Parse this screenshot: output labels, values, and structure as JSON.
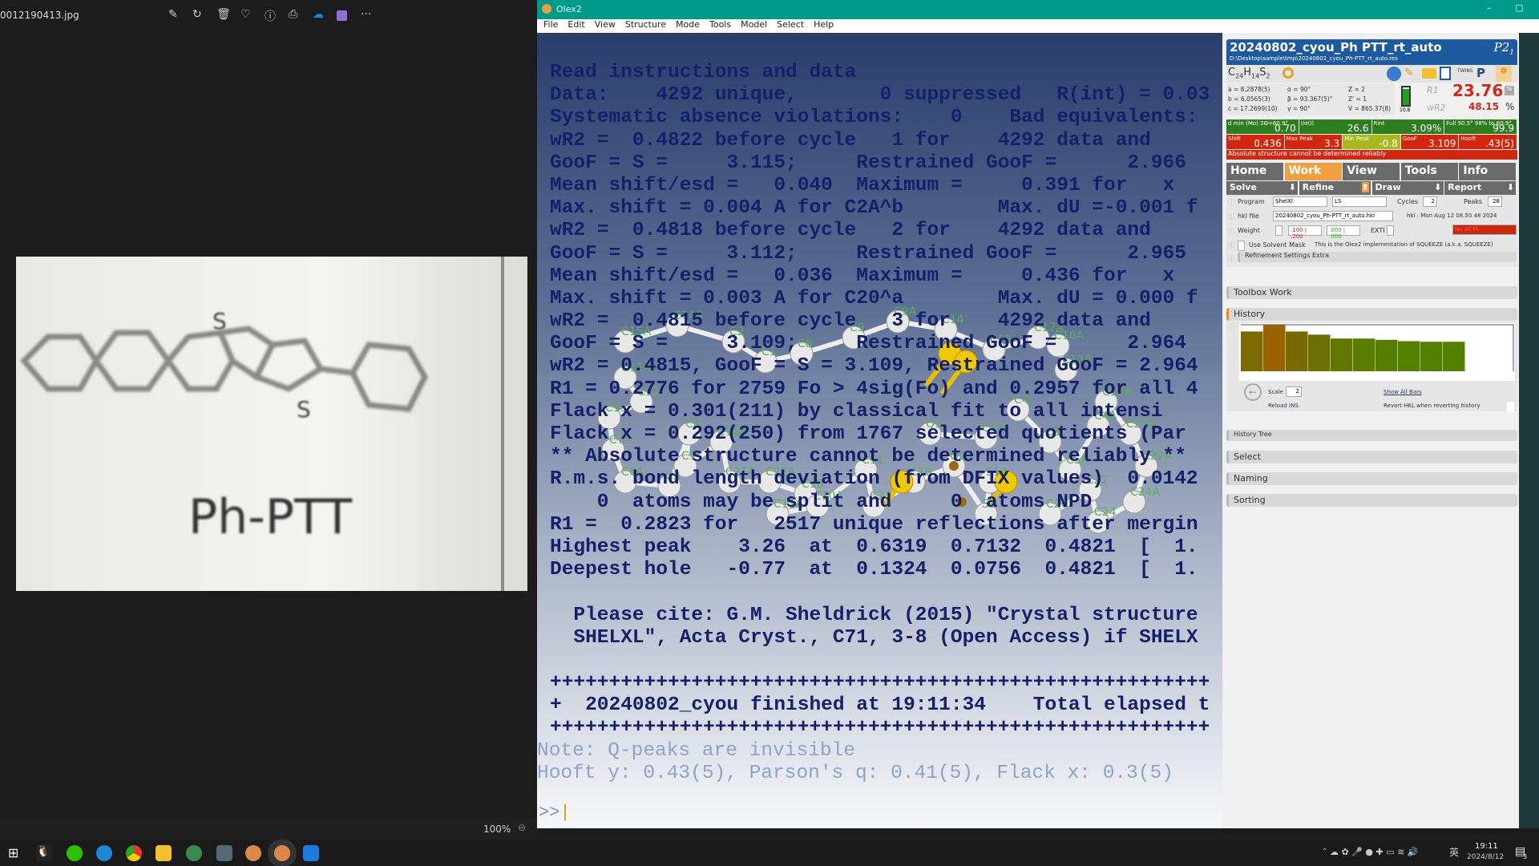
{
  "viewer": {
    "filename": "0012190413.jpg",
    "toolbar_icons": [
      "edit-image-icon",
      "rotate-icon",
      "delete-icon",
      "favorite-icon",
      "info-icon",
      "print-icon",
      "onedrive-icon",
      "clipchamp-icon",
      "more-icon"
    ],
    "more_label": "···",
    "zoom": "100%",
    "photo_label": "Ph-PTT"
  },
  "olex": {
    "title": "Olex2",
    "menu": [
      "File",
      "Edit",
      "View",
      "Structure",
      "Mode",
      "Tools",
      "Model",
      "Select",
      "Help"
    ]
  },
  "console": {
    "lines": [
      "Read instructions and data",
      "Data:    4292 unique,       0 suppressed   R(int) = 0.03",
      "Systematic absence violations:    0    Bad equivalents:",
      "wR2 =  0.4822 before cycle   1 for    4292 data and",
      "GooF = S =     3.115;     Restrained GooF =      2.966",
      "Mean shift/esd =   0.040  Maximum =     0.391 for   x",
      "Max. shift = 0.004 A for C2A^b        Max. dU =-0.001 f",
      "wR2 =  0.4818 before cycle   2 for    4292 data and",
      "GooF = S =     3.112;     Restrained GooF =      2.965",
      "Mean shift/esd =   0.036  Maximum =     0.436 for   x",
      "Max. shift = 0.003 A for C20^a        Max. dU = 0.000 f",
      "wR2 =  0.4815 before cycle   3 for    4292 data and",
      "GooF = S =     3.109;     Restrained GooF =      2.964",
      "wR2 = 0.4815, GooF = S = 3.109, Restrained GooF = 2.964",
      "R1 = 0.2776 for 2759 Fo > 4sig(Fo) and 0.2957 for all 4",
      "Flack x = 0.301(211) by classical fit to all intensi",
      "Flack x = 0.292(250) from 1767 selected quotients (Par",
      "** Absolute structure cannot be determined reliably **",
      "R.m.s. bond length deviation (from DFIX values)  0.0142",
      "    0  atoms may be split and     0  atoms NPD",
      "R1 =  0.2823 for   2517 unique reflections after mergin",
      "Highest peak    3.26  at  0.6319  0.7132  0.4821  [  1.",
      "Deepest hole   -0.77  at  0.1324  0.0756  0.4821  [  1.",
      "",
      "  Please cite: G.M. Sheldrick (2015) \"Crystal structure",
      "  SHELXL\", Acta Cryst., C71, 3-8 (Open Access) if SHELX",
      "",
      "++++++++++++++++++++++++++++++++++++++++++++++++++++++++",
      "+  20240802_cyou finished at 19:11:34    Total elapsed t",
      "++++++++++++++++++++++++++++++++++++++++++++++++++++++++"
    ],
    "notes": [
      "Note: Q-peaks are invisible",
      "Hooft y: 0.43(5), Parson's q: 0.41(5), Flack x: 0.3(5)"
    ],
    "prompt": ">>"
  },
  "atom_labels": [
    "C15A",
    "C14A",
    "C2",
    "C1",
    "C8",
    "C9",
    "C9A",
    "C14",
    "C15",
    "C17A",
    "C16A",
    "C13A",
    "C12A",
    "C12",
    "C13",
    "C7A",
    "C6A",
    "C3",
    "C6",
    "C7",
    "C18A",
    "C21A",
    "C22A",
    "C10",
    "C11A",
    "C10A",
    "C11",
    "C21",
    "C18",
    "Q2",
    "S1",
    "S1A",
    "C4",
    "C5",
    "C5A",
    "C4A",
    "C19A",
    "C20A",
    "C21A",
    "C24A",
    "C24",
    "C22",
    "C20",
    "C19",
    "Q1"
  ],
  "panel": {
    "title": "20240802_cyou_Ph PTT_rt_auto",
    "space_group": "P2",
    "space_group_sub": "1",
    "path": "D:\\Desktop\\sample\\tmp\\20240802_cyou_Ph-PTT_rt_auto.res",
    "formula": {
      "c": "C",
      "c_n": "24",
      "h": "H",
      "h_n": "14",
      "s": "S",
      "s_n": "2"
    },
    "cell": [
      "a = 8.2878(5)",
      "α = 90°",
      "Z = 2",
      "b = 6.0565(3)",
      "β = 93.367(5)°",
      "Z' = 1",
      "c = 17.2699(10)",
      "γ = 90°",
      "V = 865.37(8)"
    ],
    "battery": "10.8",
    "r1_label": "R1",
    "r1": "23.76",
    "wr2_label": "wR2",
    "wr2": "48.15",
    "pct": "%",
    "stats1": [
      {
        "label": "d min (Mo) 2Θ=60.9°",
        "value": "0.70",
        "color": "#2e7d1f"
      },
      {
        "label": "I/σ(I)",
        "value": "26.6",
        "color": "#2e7d1f"
      },
      {
        "label": "Rint",
        "value": "3.09%",
        "color": "#2e7d1f"
      },
      {
        "label": "Full 50.5° 98% to 60.9°",
        "value": "99.9",
        "color": "#2e7d1f"
      }
    ],
    "stats2": [
      {
        "label": "Shift",
        "value": "0.436",
        "color": "#d2260f"
      },
      {
        "label": "Max Peak",
        "value": "3.3",
        "color": "#d2260f"
      },
      {
        "label": "Min Peak",
        "value": "-0.8",
        "color": "#a8b81e"
      },
      {
        "label": "GooF",
        "value": "3.109",
        "color": "#d2260f"
      },
      {
        "label": "Hooft",
        "value": ".43(5)",
        "color": "#d2260f"
      }
    ],
    "warning": "Absolute structure cannot be determined reliably",
    "tabs": [
      "Home",
      "Work",
      "View",
      "Tools",
      "Info"
    ],
    "active_tab": "Work",
    "subtabs": [
      "Solve",
      "Refine",
      "Draw",
      "Report"
    ],
    "program_label": "Program",
    "program": "ShelXl",
    "method": "LS",
    "cycles_label": "Cycles",
    "cycles": "2",
    "peaks_label": "Peaks",
    "peaks": "28",
    "hkl_label": "hkl file",
    "hkl": "20240802_cyou_Ph-PTT_rt_auto.hkl",
    "hkl_date": "hkl : Mon Aug 12 08.50 48 2024",
    "weight_label": "Weight",
    "weight_red": ".100 | .200",
    "weight_green": ".000 | .000",
    "exti_label": "EXTI",
    "acta": "No ACTA",
    "solvent_label": "Use Solvent Mask",
    "solvent_note": "This is the Olex2 implementation of SQUEEZE (a.k.a. SQUEEZE)",
    "refinement_extra": "Refinement Settings Extra",
    "sections": [
      "Toolbox Work",
      "History"
    ],
    "history_bars": [
      0.62,
      0.72,
      0.62,
      0.57,
      0.51,
      0.51,
      0.49,
      0.47,
      0.46,
      0.46
    ],
    "history_colors": [
      "#7a6a00",
      "#9a6200",
      "#776a00",
      "#6b7000",
      "#5e7800",
      "#5a7c00",
      "#587e00",
      "#568000",
      "#548000",
      "#548000"
    ],
    "scale_label": "Scale",
    "scale": "2",
    "show_all_bars": "Show All Bars",
    "reload_ins": "Reload INS",
    "revert_hkl": "Revert HKL when reverting history",
    "history_tree": "History Tree",
    "bottom_sections": [
      "Select",
      "Naming",
      "Sorting"
    ]
  },
  "tray": {
    "time": "19:11",
    "date": "2024/8/12",
    "ime": "英",
    "notifications": "3"
  }
}
